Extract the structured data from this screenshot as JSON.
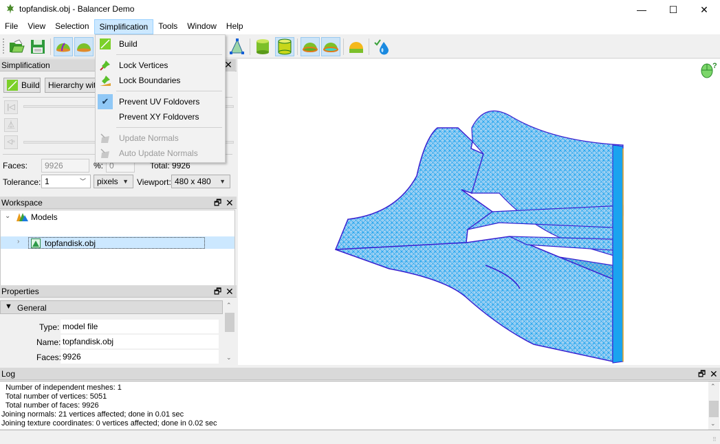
{
  "window": {
    "title": "topfandisk.obj - Balancer Demo",
    "controls": {
      "minimize": "—",
      "maximize": "☐",
      "close": "✕"
    }
  },
  "menubar": {
    "items": [
      "File",
      "View",
      "Selection",
      "Simplification",
      "Tools",
      "Window",
      "Help"
    ],
    "active": "Simplification"
  },
  "toolbar": {
    "buttons": [
      {
        "icon": "open-file-icon",
        "checked": false
      },
      {
        "icon": "save-icon",
        "checked": false
      },
      {
        "icon": "dome-with-seam-icon",
        "checked": true
      },
      {
        "icon": "dome-icon",
        "checked": true
      },
      {
        "icon": "wireframe-pyramid-icon",
        "checked": false
      },
      {
        "icon": "cylinder-icon",
        "checked": false
      },
      {
        "icon": "cylinder-outline-icon",
        "checked": true
      },
      {
        "icon": "dome-boundary-icon",
        "checked": true
      },
      {
        "icon": "dome-boundary-teal-icon",
        "checked": true
      },
      {
        "icon": "dome-orange-icon",
        "checked": false
      },
      {
        "icon": "water-drop-check-icon",
        "checked": false
      }
    ]
  },
  "simplification_menu": {
    "items": [
      {
        "label": "Build",
        "icon": "build-icon",
        "enabled": true,
        "checked": false
      },
      {
        "separator": true
      },
      {
        "label": "Lock Vertices",
        "icon": "pin-icon",
        "enabled": true,
        "checked": false
      },
      {
        "label": "Lock Boundaries",
        "icon": "pin-boundary-icon",
        "enabled": true,
        "checked": false
      },
      {
        "separator": true
      },
      {
        "label": "Prevent UV Foldovers",
        "icon": "checkmark-icon",
        "enabled": true,
        "checked": true
      },
      {
        "label": "Prevent XY Foldovers",
        "icon": "",
        "enabled": true,
        "checked": false
      },
      {
        "separator": true
      },
      {
        "label": "Update Normals",
        "icon": "normals-icon",
        "enabled": false,
        "checked": false
      },
      {
        "label": "Auto Update Normals",
        "icon": "auto-normals-icon",
        "enabled": false,
        "checked": false
      }
    ]
  },
  "simplification_panel": {
    "title": "Simplification",
    "build_label": "Build",
    "hierarchy_label": "Hierarchy with",
    "faces_label": "Faces:",
    "faces_value": "9926",
    "percent_label": "%:",
    "percent_value": "0",
    "total_label": "Total: 9926",
    "tolerance_label": "Tolerance:",
    "tolerance_value": "1",
    "units_value": "pixels",
    "viewport_label": "Viewport:",
    "viewport_value": "480 x 480"
  },
  "workspace": {
    "title": "Workspace",
    "tree": [
      {
        "label": "Models",
        "expanded": true,
        "children": [
          {
            "label": "topfandisk.obj",
            "selected": true
          }
        ]
      }
    ]
  },
  "properties": {
    "title": "Properties",
    "section": "General",
    "rows": [
      {
        "key": "Type:",
        "value": "model file"
      },
      {
        "key": "Name:",
        "value": "topfandisk.obj"
      },
      {
        "key": "Faces:",
        "value": "9926"
      }
    ]
  },
  "log": {
    "title": "Log",
    "lines": [
      "  Number of independent meshes: 1",
      "  Total number of vertices: 5051",
      "  Total number of faces: 9926",
      "Joining normals: 21 vertices affected; done in 0.01 sec",
      "Joining texture coordinates: 0 vertices affected; done in 0.02 sec"
    ]
  },
  "viewport": {
    "help_icon": "mouse-help-icon",
    "mesh_color": "#1aa3ef",
    "edge_color": "#3a1fd0"
  }
}
